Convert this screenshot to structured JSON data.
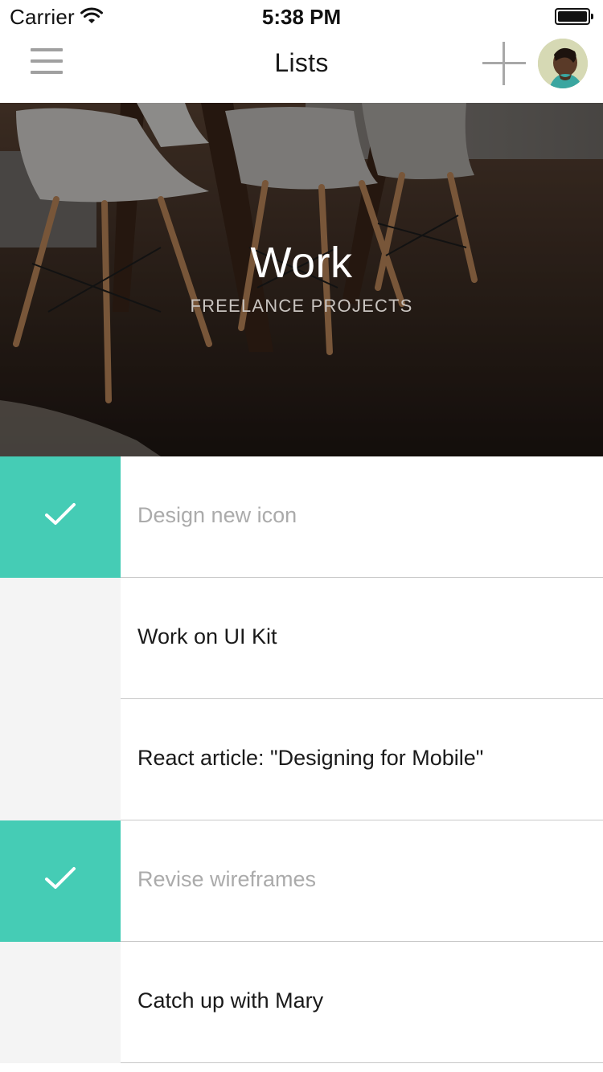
{
  "status_bar": {
    "carrier": "Carrier",
    "time": "5:38 PM",
    "icons": [
      "wifi-icon",
      "battery-icon"
    ]
  },
  "nav": {
    "title": "Lists",
    "left_icon": "menu-icon",
    "right_icon": "plus-icon"
  },
  "hero": {
    "title": "Work",
    "subtitle": "FREELANCE PROJECTS"
  },
  "colors": {
    "accent": "#45ccb5",
    "unchecked_bg": "#f4f4f4",
    "done_text": "#ababab",
    "text": "#1a1a1a"
  },
  "tasks": [
    {
      "label": "Design new icon",
      "done": true
    },
    {
      "label": "Work on UI Kit",
      "done": false
    },
    {
      "label": "React article: \"Designing for Mobile\"",
      "done": false
    },
    {
      "label": "Revise wireframes",
      "done": true
    },
    {
      "label": "Catch up with Mary",
      "done": false
    }
  ]
}
